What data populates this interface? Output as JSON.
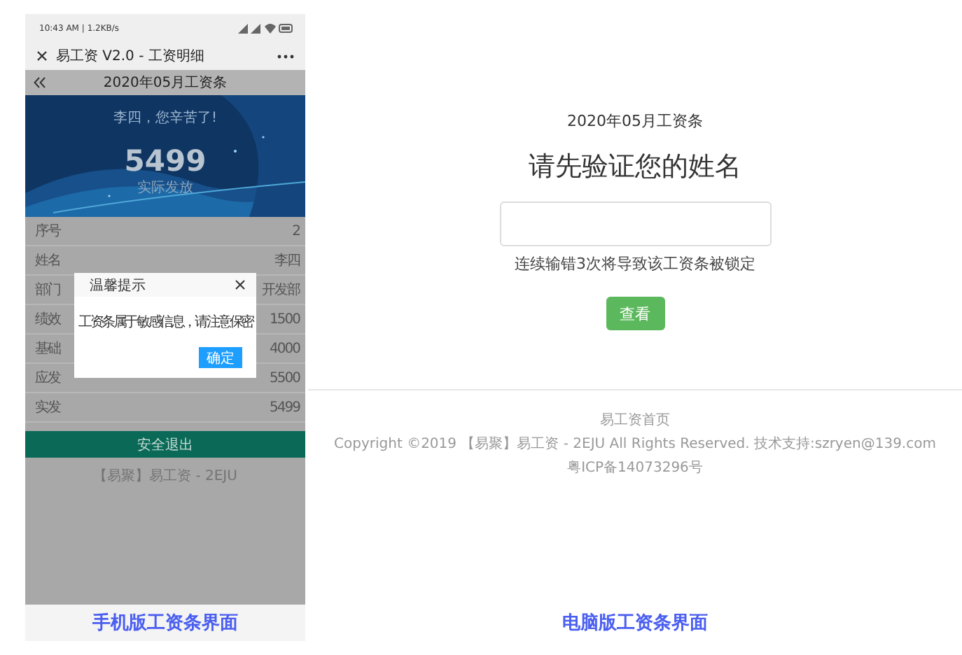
{
  "phone": {
    "status_bar": {
      "time": "10:43 AM | 1.2KB/s"
    },
    "title_bar": {
      "title": "易工资 V2.0 - 工资明细"
    },
    "header": {
      "title": "2020年05月工资条"
    },
    "banner": {
      "greeting": "李四，您辛苦了!",
      "amount": "5499",
      "amount_label": "实际发放"
    },
    "rows": [
      {
        "label": "序号",
        "value": "2"
      },
      {
        "label": "姓名",
        "value": "李四"
      },
      {
        "label": "部门",
        "value": "开发部"
      },
      {
        "label": "绩效",
        "value": "1500"
      },
      {
        "label": "基础",
        "value": "4000"
      },
      {
        "label": "应发",
        "value": "5500"
      },
      {
        "label": "实发",
        "value": "5499"
      }
    ],
    "exit_button": "安全退出",
    "footer": "【易聚】易工资 - 2EJU",
    "dialog": {
      "title": "温馨提示",
      "message": "工资条属于敏感信息，请注意保密",
      "button": "确定"
    },
    "caption": "手机版工资条界面"
  },
  "desktop": {
    "month": "2020年05月工资条",
    "heading": "请先验证您的姓名",
    "hint": "连续输错3次将导致该工资条被锁定",
    "button": "查看",
    "footer": [
      "易工资首页",
      "Copyright ©2019 【易聚】易工资 - 2EJU All Rights Reserved. 技术支持:szryen@139.com",
      "粤ICP备14073296号"
    ],
    "caption": "电脑版工资条界面"
  }
}
